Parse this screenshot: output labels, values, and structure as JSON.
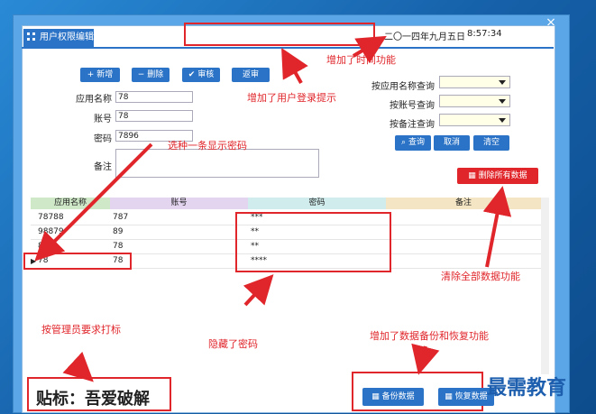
{
  "window": {
    "tab_label": "用户权限编辑",
    "close_glyph": "×"
  },
  "header": {
    "date": "二〇一四年九月五日",
    "time": "8:57:34"
  },
  "toolbar": {
    "add": "+ 新增",
    "delete": "− 删除",
    "review": "✔ 审核",
    "return": "返审"
  },
  "form": {
    "app_name_label": "应用名称",
    "app_name_value": "78",
    "account_label": "账号",
    "account_value": "78",
    "password_label": "密码",
    "password_value": "7896",
    "note_label": "备注",
    "note_value": ""
  },
  "search": {
    "by_app_label": "按应用名称查询",
    "by_account_label": "按账号查询",
    "by_note_label": "按备注查询",
    "query": "查询",
    "cancel": "取消",
    "clear": "清空"
  },
  "delete_all": "删除所有数据",
  "table": {
    "columns": [
      "应用名称",
      "账号",
      "密码",
      "备注"
    ],
    "rows": [
      [
        "78788",
        "787",
        "***",
        ""
      ],
      [
        "98879",
        "89",
        "**",
        ""
      ],
      [
        "878",
        "78",
        "**",
        ""
      ],
      [
        "78",
        "78",
        "****",
        ""
      ]
    ]
  },
  "bottom": {
    "backup": "备份数据",
    "restore": "恢复数据"
  },
  "annotations": {
    "time_feature": "增加了时间功能",
    "login_hint": "增加了用户登录提示",
    "show_password": "选种一条显示密码",
    "clear_all": "清除全部数据功能",
    "admin_mark": "按管理员要求打标",
    "hidden_password": "隐藏了密码",
    "backup_restore": "增加了数据备份和恢复功能"
  },
  "watermark": "贴标：吾爱破解",
  "site_logo": "最需教育",
  "colors": {
    "accent": "#2b73c6",
    "annotation": "#e0262b"
  }
}
